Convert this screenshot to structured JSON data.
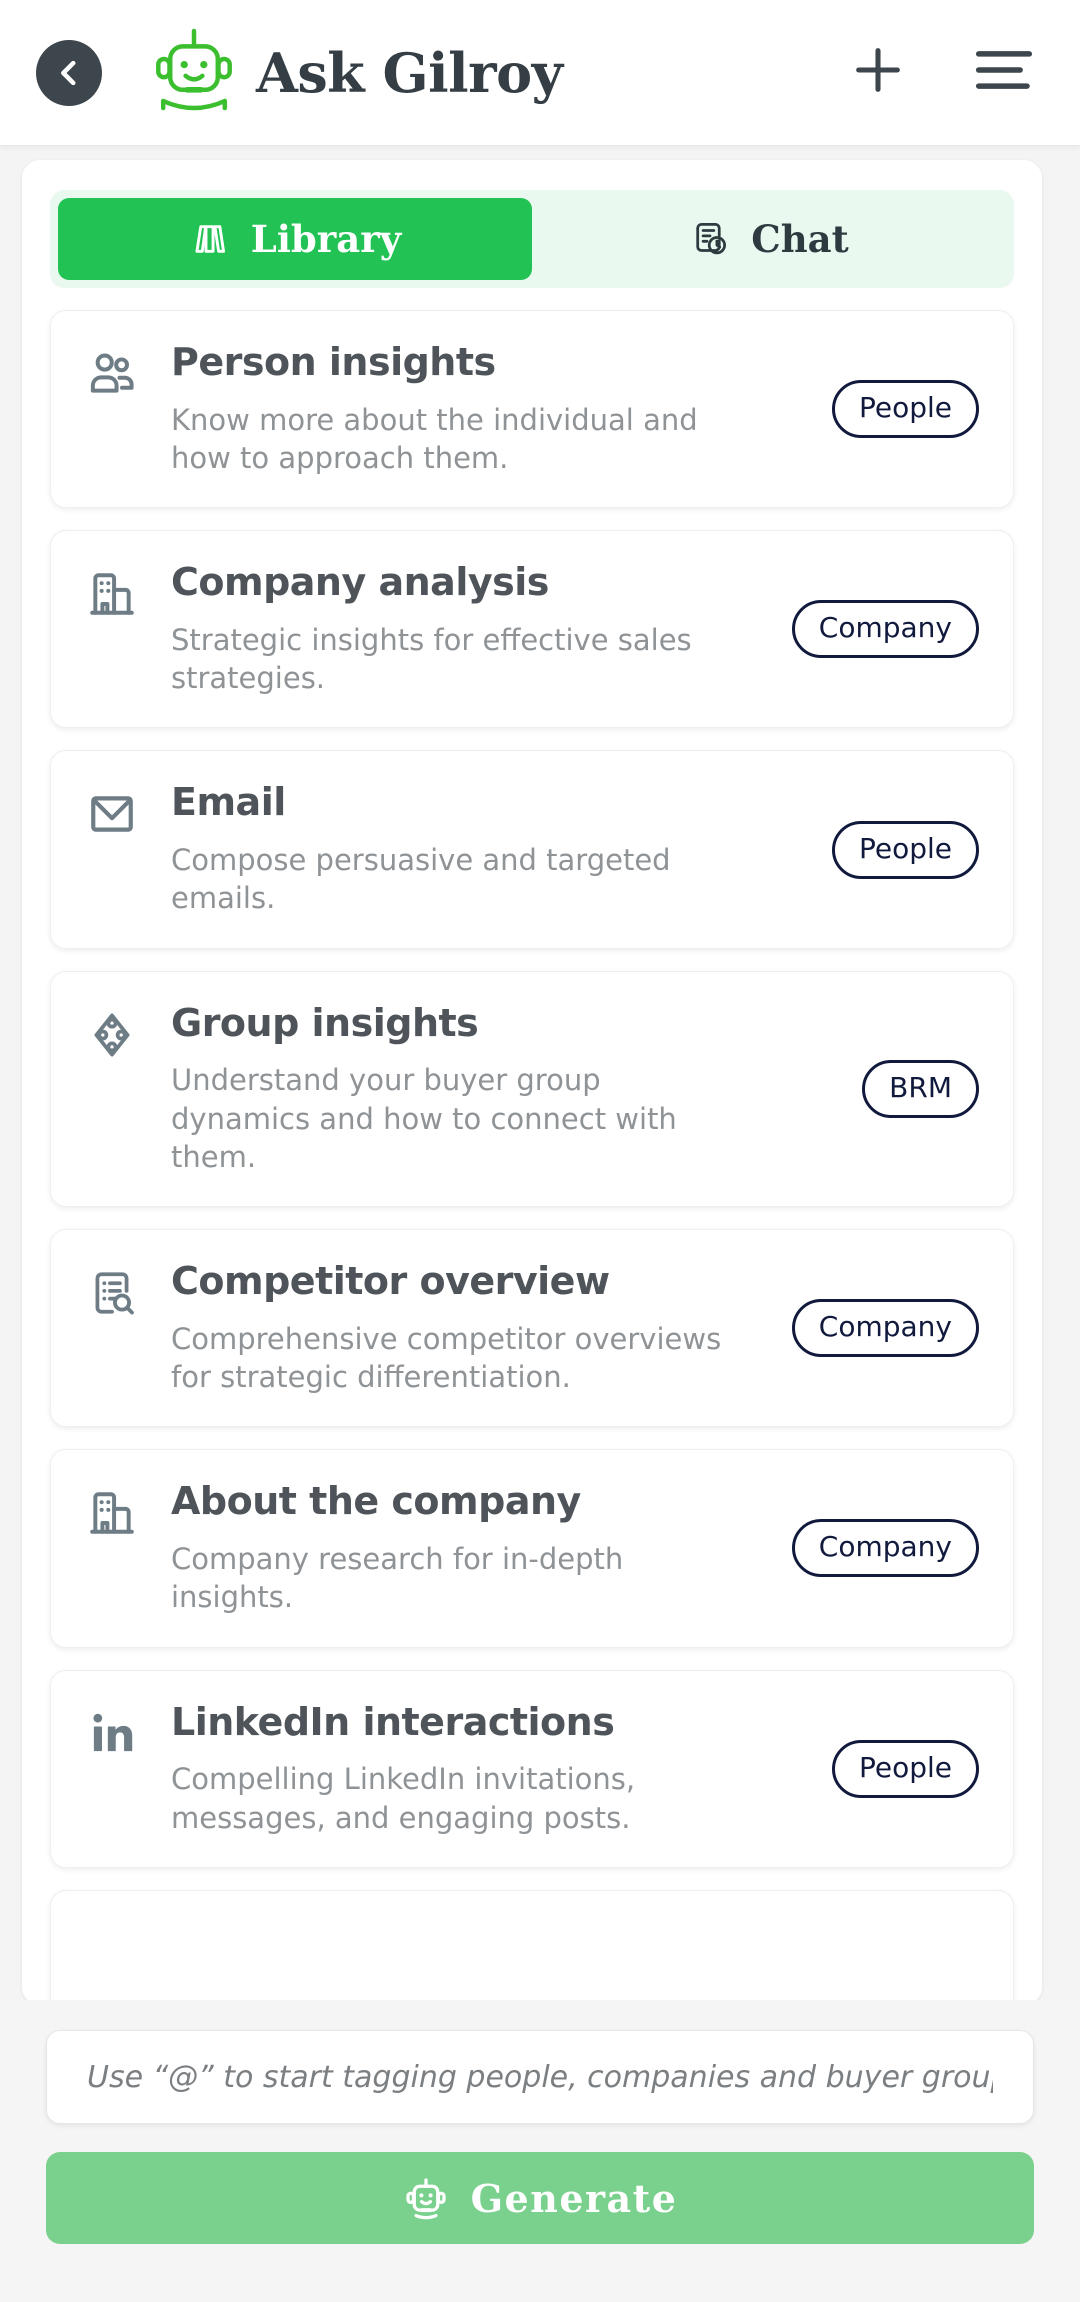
{
  "header": {
    "back_icon": "chevron-left-icon",
    "logo_icon": "robot-logo-icon",
    "title": "Ask Gilroy",
    "add_icon": "plus-icon",
    "menu_icon": "hamburger-menu-icon"
  },
  "tabs": [
    {
      "label": "Library",
      "icon": "books-icon",
      "active": true
    },
    {
      "label": "Chat",
      "icon": "chat-history-icon",
      "active": false
    }
  ],
  "colors": {
    "accent_green": "#22c354",
    "tab_container": "#eaf9ef",
    "badge_navy": "#111a3d",
    "generate_green": "#79d18d",
    "title_gray": "#4e5459",
    "desc_gray": "#8f9396"
  },
  "cards": [
    {
      "title": "Person insights",
      "desc": "Know more about the individual and how to approach them.",
      "badge": "People",
      "icon": "people-icon"
    },
    {
      "title": "Company analysis",
      "desc": "Strategic insights for effective sales strategies.",
      "badge": "Company",
      "icon": "building-icon"
    },
    {
      "title": "Email",
      "desc": "Compose persuasive and targeted emails.",
      "badge": "People",
      "icon": "envelope-icon"
    },
    {
      "title": "Group insights",
      "desc": "Understand your buyer group dynamics and how to connect with them.",
      "badge": "BRM",
      "icon": "network-diamond-icon"
    },
    {
      "title": "Competitor overview",
      "desc": "Comprehensive competitor overviews for strategic differentiation.",
      "badge": "Company",
      "icon": "document-search-icon"
    },
    {
      "title": "About the company",
      "desc": "Company research for in-depth insights.",
      "badge": "Company",
      "icon": "building-icon"
    },
    {
      "title": "LinkedIn interactions",
      "desc": "Compelling LinkedIn invitations, messages, and engaging posts.",
      "badge": "People",
      "icon": "linkedin-icon"
    }
  ],
  "composer": {
    "placeholder": "Use “@” to start tagging people, companies and buyer groups",
    "value": "",
    "generate_label": "Generate",
    "generate_icon": "robot-icon"
  }
}
